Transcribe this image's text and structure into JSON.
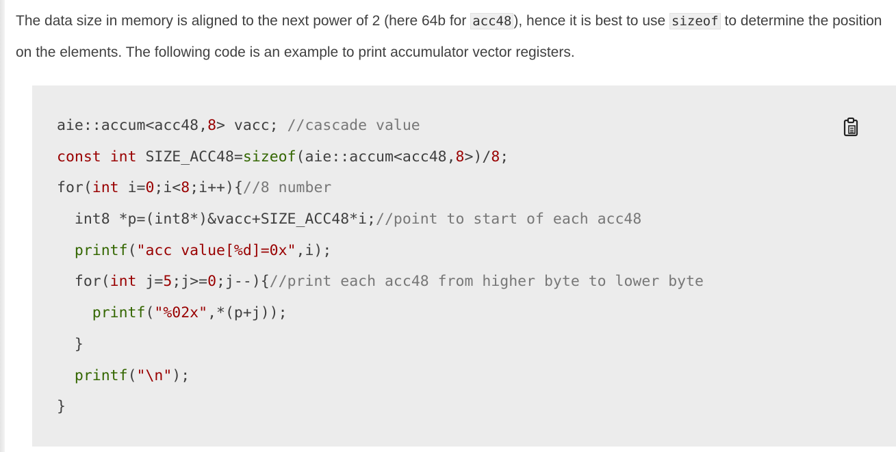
{
  "paragraph": {
    "text_1": "The data size in memory is aligned to the next power of 2 (here 64b for ",
    "code_1": "acc48",
    "text_2": "), hence it is best to use ",
    "code_2": "sizeof",
    "text_3": " to determine the position on the elements. The following code is an example to print accumulator vector registers."
  },
  "code_block": {
    "copy_icon": "clipboard-icon",
    "lines": [
      [
        {
          "t": "aie::accum<acc48,",
          "c": ""
        },
        {
          "t": "8",
          "c": "num"
        },
        {
          "t": "> vacc; ",
          "c": ""
        },
        {
          "t": "//cascade value",
          "c": "cm"
        }
      ],
      [
        {
          "t": "const",
          "c": "kw"
        },
        {
          "t": " ",
          "c": ""
        },
        {
          "t": "int",
          "c": "kw"
        },
        {
          "t": " SIZE_ACC48=",
          "c": ""
        },
        {
          "t": "sizeof",
          "c": "fn"
        },
        {
          "t": "(aie::accum<acc48,",
          "c": ""
        },
        {
          "t": "8",
          "c": "num"
        },
        {
          "t": ">)/",
          "c": ""
        },
        {
          "t": "8",
          "c": "num"
        },
        {
          "t": ";",
          "c": ""
        }
      ],
      [
        {
          "t": "for(",
          "c": ""
        },
        {
          "t": "int",
          "c": "kw"
        },
        {
          "t": " i=",
          "c": ""
        },
        {
          "t": "0",
          "c": "num"
        },
        {
          "t": ";i<",
          "c": ""
        },
        {
          "t": "8",
          "c": "num"
        },
        {
          "t": ";i++){",
          "c": ""
        },
        {
          "t": "//8 number",
          "c": "cm"
        }
      ],
      [
        {
          "t": "  int8 *p=(int8*)&vacc+SIZE_ACC48*i;",
          "c": ""
        },
        {
          "t": "//point to start of each acc48",
          "c": "cm"
        }
      ],
      [
        {
          "t": "  ",
          "c": ""
        },
        {
          "t": "printf",
          "c": "fn"
        },
        {
          "t": "(",
          "c": ""
        },
        {
          "t": "\"acc value[%d]=0x\"",
          "c": "str"
        },
        {
          "t": ",i);",
          "c": ""
        }
      ],
      [
        {
          "t": "  for(",
          "c": ""
        },
        {
          "t": "int",
          "c": "kw"
        },
        {
          "t": " j=",
          "c": ""
        },
        {
          "t": "5",
          "c": "num"
        },
        {
          "t": ";j>=",
          "c": ""
        },
        {
          "t": "0",
          "c": "num"
        },
        {
          "t": ";j--){",
          "c": ""
        },
        {
          "t": "//print each acc48 from higher byte to lower byte",
          "c": "cm"
        }
      ],
      [
        {
          "t": "    ",
          "c": ""
        },
        {
          "t": "printf",
          "c": "fn"
        },
        {
          "t": "(",
          "c": ""
        },
        {
          "t": "\"%02x\"",
          "c": "str"
        },
        {
          "t": ",*(p+j));",
          "c": ""
        }
      ],
      [
        {
          "t": "  }",
          "c": ""
        }
      ],
      [
        {
          "t": "  ",
          "c": ""
        },
        {
          "t": "printf",
          "c": "fn"
        },
        {
          "t": "(",
          "c": ""
        },
        {
          "t": "\"\\n\"",
          "c": "str"
        },
        {
          "t": ");",
          "c": ""
        }
      ],
      [
        {
          "t": "}",
          "c": ""
        }
      ]
    ]
  }
}
